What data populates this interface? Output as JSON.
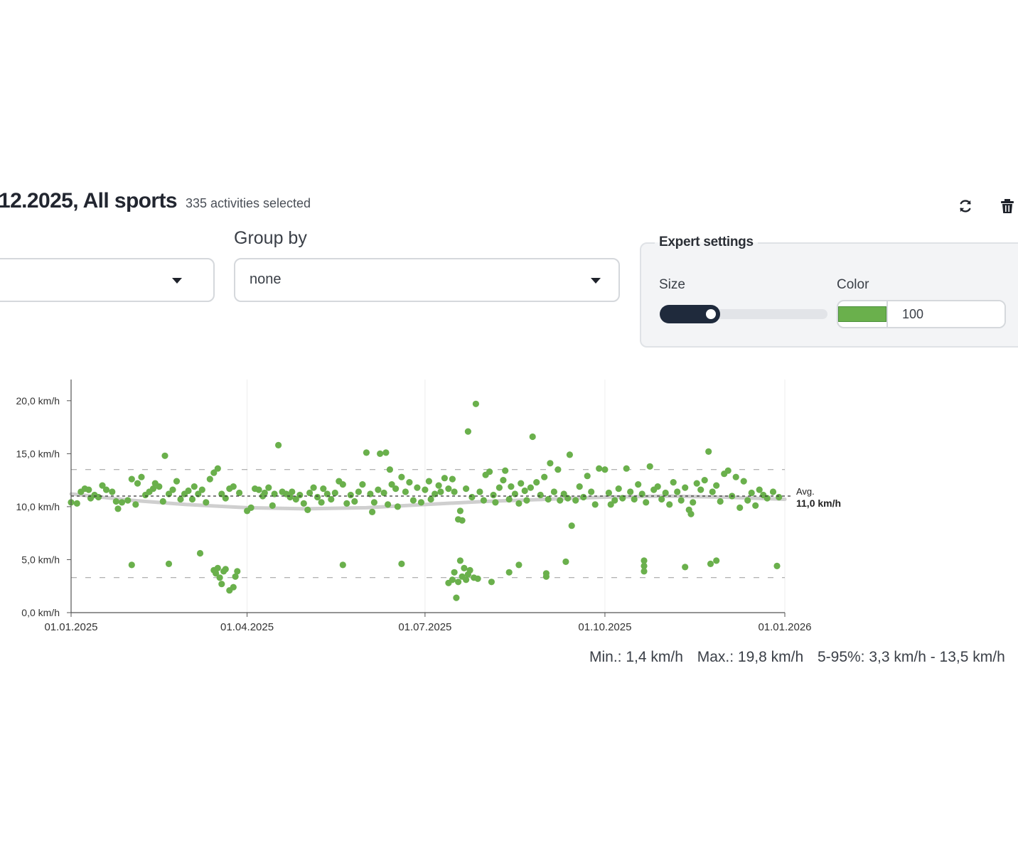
{
  "header": {
    "title": "12.2025, All sports",
    "subtitle": "335 activities selected",
    "refresh_icon": "refresh-icon",
    "delete_icon": "trash-icon"
  },
  "filters": {
    "first_select": {
      "value": ""
    },
    "group_by": {
      "label": "Group by",
      "value": "none"
    }
  },
  "expert": {
    "legend": "Expert settings",
    "size_label": "Size",
    "size_value": 0.36,
    "color_label": "Color",
    "color": "#6ab04c",
    "opacity": "100"
  },
  "stats": {
    "min": "Min.: 1,4 km/h",
    "max": "Max.: 19,8 km/h",
    "range": "5-95%: 3,3 km/h - 13,5 km/h"
  },
  "chart_data": {
    "type": "scatter",
    "title": "",
    "xlabel": "",
    "ylabel": "",
    "unit": "km/h",
    "x_range": [
      "2025-01-01",
      "2026-01-01"
    ],
    "ylim": [
      0,
      22
    ],
    "x_ticks": [
      {
        "date": "2025-01-01",
        "label": "01.01.2025"
      },
      {
        "date": "2025-04-01",
        "label": "01.04.2025"
      },
      {
        "date": "2025-07-01",
        "label": "01.07.2025"
      },
      {
        "date": "2025-10-01",
        "label": "01.10.2025"
      },
      {
        "date": "2026-01-01",
        "label": "01.01.2026"
      }
    ],
    "y_ticks": [
      {
        "value": 0,
        "label": "0,0 km/h"
      },
      {
        "value": 5,
        "label": "5,0 km/h"
      },
      {
        "value": 10,
        "label": "10,0 km/h"
      },
      {
        "value": 15,
        "label": "15,0 km/h"
      },
      {
        "value": 20,
        "label": "20,0 km/h"
      }
    ],
    "average": {
      "value": 11.0,
      "label": "Avg.",
      "value_label": "11,0 km/h"
    },
    "percentile_lines": [
      3.3,
      13.5
    ],
    "trend": [
      {
        "x": "2025-01-01",
        "y": 11.2
      },
      {
        "x": "2025-02-01",
        "y": 10.6
      },
      {
        "x": "2025-03-01",
        "y": 10.2
      },
      {
        "x": "2025-04-01",
        "y": 9.9
      },
      {
        "x": "2025-05-01",
        "y": 9.8
      },
      {
        "x": "2025-06-01",
        "y": 9.9
      },
      {
        "x": "2025-07-01",
        "y": 10.2
      },
      {
        "x": "2025-08-01",
        "y": 10.5
      },
      {
        "x": "2025-09-01",
        "y": 10.7
      },
      {
        "x": "2025-10-01",
        "y": 10.9
      },
      {
        "x": "2025-11-01",
        "y": 11.0
      },
      {
        "x": "2025-12-01",
        "y": 10.9
      },
      {
        "x": "2026-01-01",
        "y": 10.7
      }
    ],
    "points": [
      {
        "x": "2025-01-01",
        "y": 10.4
      },
      {
        "x": "2025-01-04",
        "y": 10.3
      },
      {
        "x": "2025-01-06",
        "y": 11.4
      },
      {
        "x": "2025-01-08",
        "y": 11.7
      },
      {
        "x": "2025-01-10",
        "y": 11.6
      },
      {
        "x": "2025-01-11",
        "y": 10.8
      },
      {
        "x": "2025-01-13",
        "y": 11.1
      },
      {
        "x": "2025-01-15",
        "y": 10.9
      },
      {
        "x": "2025-01-17",
        "y": 12.0
      },
      {
        "x": "2025-01-19",
        "y": 11.6
      },
      {
        "x": "2025-01-22",
        "y": 11.4
      },
      {
        "x": "2025-01-24",
        "y": 10.5
      },
      {
        "x": "2025-01-25",
        "y": 9.8
      },
      {
        "x": "2025-01-27",
        "y": 10.4
      },
      {
        "x": "2025-01-30",
        "y": 10.6
      },
      {
        "x": "2025-02-01",
        "y": 12.6
      },
      {
        "x": "2025-02-03",
        "y": 10.2
      },
      {
        "x": "2025-02-04",
        "y": 12.2
      },
      {
        "x": "2025-02-06",
        "y": 12.8
      },
      {
        "x": "2025-02-08",
        "y": 11.1
      },
      {
        "x": "2025-02-10",
        "y": 11.4
      },
      {
        "x": "2025-02-12",
        "y": 11.7
      },
      {
        "x": "2025-02-13",
        "y": 12.2
      },
      {
        "x": "2025-02-15",
        "y": 11.9
      },
      {
        "x": "2025-02-17",
        "y": 10.5
      },
      {
        "x": "2025-02-18",
        "y": 14.8
      },
      {
        "x": "2025-02-20",
        "y": 11.2
      },
      {
        "x": "2025-02-22",
        "y": 11.6
      },
      {
        "x": "2025-02-24",
        "y": 12.4
      },
      {
        "x": "2025-02-26",
        "y": 10.7
      },
      {
        "x": "2025-02-28",
        "y": 11.2
      },
      {
        "x": "2025-03-02",
        "y": 11.5
      },
      {
        "x": "2025-03-04",
        "y": 10.7
      },
      {
        "x": "2025-03-05",
        "y": 11.9
      },
      {
        "x": "2025-03-07",
        "y": 11.2
      },
      {
        "x": "2025-03-09",
        "y": 11.6
      },
      {
        "x": "2025-03-11",
        "y": 10.4
      },
      {
        "x": "2025-03-13",
        "y": 12.6
      },
      {
        "x": "2025-03-15",
        "y": 13.2
      },
      {
        "x": "2025-03-17",
        "y": 13.6
      },
      {
        "x": "2025-03-19",
        "y": 11.2
      },
      {
        "x": "2025-03-21",
        "y": 10.8
      },
      {
        "x": "2025-03-23",
        "y": 11.7
      },
      {
        "x": "2025-03-25",
        "y": 11.9
      },
      {
        "x": "2025-03-28",
        "y": 11.3
      },
      {
        "x": "2025-04-01",
        "y": 9.6
      },
      {
        "x": "2025-04-03",
        "y": 9.9
      },
      {
        "x": "2025-04-05",
        "y": 11.7
      },
      {
        "x": "2025-04-07",
        "y": 11.6
      },
      {
        "x": "2025-04-09",
        "y": 11.0
      },
      {
        "x": "2025-04-10",
        "y": 11.3
      },
      {
        "x": "2025-04-12",
        "y": 11.8
      },
      {
        "x": "2025-04-14",
        "y": 10.1
      },
      {
        "x": "2025-04-15",
        "y": 11.2
      },
      {
        "x": "2025-04-17",
        "y": 15.8
      },
      {
        "x": "2025-04-19",
        "y": 11.4
      },
      {
        "x": "2025-04-21",
        "y": 11.2
      },
      {
        "x": "2025-04-23",
        "y": 10.9
      },
      {
        "x": "2025-04-24",
        "y": 11.4
      },
      {
        "x": "2025-04-26",
        "y": 10.7
      },
      {
        "x": "2025-04-28",
        "y": 11.1
      },
      {
        "x": "2025-04-30",
        "y": 10.3
      },
      {
        "x": "2025-05-02",
        "y": 9.7
      },
      {
        "x": "2025-05-03",
        "y": 11.3
      },
      {
        "x": "2025-05-05",
        "y": 11.8
      },
      {
        "x": "2025-05-07",
        "y": 10.9
      },
      {
        "x": "2025-05-09",
        "y": 10.4
      },
      {
        "x": "2025-05-10",
        "y": 11.7
      },
      {
        "x": "2025-05-12",
        "y": 11.2
      },
      {
        "x": "2025-05-14",
        "y": 10.7
      },
      {
        "x": "2025-05-16",
        "y": 11.3
      },
      {
        "x": "2025-05-18",
        "y": 12.4
      },
      {
        "x": "2025-05-20",
        "y": 12.1
      },
      {
        "x": "2025-05-22",
        "y": 10.3
      },
      {
        "x": "2025-05-24",
        "y": 11.1
      },
      {
        "x": "2025-05-26",
        "y": 10.5
      },
      {
        "x": "2025-05-28",
        "y": 11.4
      },
      {
        "x": "2025-05-30",
        "y": 12.1
      },
      {
        "x": "2025-06-01",
        "y": 15.1
      },
      {
        "x": "2025-06-03",
        "y": 11.2
      },
      {
        "x": "2025-06-04",
        "y": 9.5
      },
      {
        "x": "2025-06-05",
        "y": 10.4
      },
      {
        "x": "2025-06-07",
        "y": 11.6
      },
      {
        "x": "2025-06-08",
        "y": 15.0
      },
      {
        "x": "2025-06-10",
        "y": 11.3
      },
      {
        "x": "2025-06-11",
        "y": 15.1
      },
      {
        "x": "2025-06-12",
        "y": 10.2
      },
      {
        "x": "2025-06-13",
        "y": 13.5
      },
      {
        "x": "2025-06-14",
        "y": 12.1
      },
      {
        "x": "2025-06-16",
        "y": 11.7
      },
      {
        "x": "2025-06-17",
        "y": 10.0
      },
      {
        "x": "2025-06-19",
        "y": 12.8
      },
      {
        "x": "2025-06-21",
        "y": 11.4
      },
      {
        "x": "2025-06-23",
        "y": 12.3
      },
      {
        "x": "2025-06-25",
        "y": 10.6
      },
      {
        "x": "2025-06-27",
        "y": 11.8
      },
      {
        "x": "2025-06-29",
        "y": 10.4
      },
      {
        "x": "2025-07-01",
        "y": 11.6
      },
      {
        "x": "2025-07-03",
        "y": 12.4
      },
      {
        "x": "2025-07-04",
        "y": 10.7
      },
      {
        "x": "2025-07-06",
        "y": 11.2
      },
      {
        "x": "2025-07-08",
        "y": 12.0
      },
      {
        "x": "2025-07-09",
        "y": 11.4
      },
      {
        "x": "2025-07-11",
        "y": 12.7
      },
      {
        "x": "2025-07-13",
        "y": 11.7
      },
      {
        "x": "2025-07-15",
        "y": 12.6
      },
      {
        "x": "2025-07-16",
        "y": 11.4
      },
      {
        "x": "2025-07-18",
        "y": 8.8
      },
      {
        "x": "2025-07-19",
        "y": 9.6
      },
      {
        "x": "2025-07-20",
        "y": 8.7
      },
      {
        "x": "2025-07-22",
        "y": 11.7
      },
      {
        "x": "2025-07-23",
        "y": 17.1
      },
      {
        "x": "2025-07-25",
        "y": 10.9
      },
      {
        "x": "2025-07-27",
        "y": 19.7
      },
      {
        "x": "2025-07-29",
        "y": 11.4
      },
      {
        "x": "2025-07-31",
        "y": 10.6
      },
      {
        "x": "2025-08-01",
        "y": 13.0
      },
      {
        "x": "2025-08-03",
        "y": 13.3
      },
      {
        "x": "2025-08-05",
        "y": 11.1
      },
      {
        "x": "2025-08-06",
        "y": 10.4
      },
      {
        "x": "2025-08-08",
        "y": 11.8
      },
      {
        "x": "2025-08-10",
        "y": 12.5
      },
      {
        "x": "2025-08-11",
        "y": 13.4
      },
      {
        "x": "2025-08-13",
        "y": 10.7
      },
      {
        "x": "2025-08-14",
        "y": 11.9
      },
      {
        "x": "2025-08-16",
        "y": 11.2
      },
      {
        "x": "2025-08-18",
        "y": 10.3
      },
      {
        "x": "2025-08-19",
        "y": 12.2
      },
      {
        "x": "2025-08-21",
        "y": 11.5
      },
      {
        "x": "2025-08-22",
        "y": 10.6
      },
      {
        "x": "2025-08-24",
        "y": 11.8
      },
      {
        "x": "2025-08-25",
        "y": 16.6
      },
      {
        "x": "2025-08-27",
        "y": 12.3
      },
      {
        "x": "2025-08-29",
        "y": 11.1
      },
      {
        "x": "2025-08-31",
        "y": 12.8
      },
      {
        "x": "2025-09-02",
        "y": 10.7
      },
      {
        "x": "2025-09-03",
        "y": 14.1
      },
      {
        "x": "2025-09-05",
        "y": 11.4
      },
      {
        "x": "2025-09-07",
        "y": 13.5
      },
      {
        "x": "2025-09-08",
        "y": 10.6
      },
      {
        "x": "2025-09-10",
        "y": 11.2
      },
      {
        "x": "2025-09-12",
        "y": 10.8
      },
      {
        "x": "2025-09-13",
        "y": 14.9
      },
      {
        "x": "2025-09-14",
        "y": 8.2
      },
      {
        "x": "2025-09-16",
        "y": 10.6
      },
      {
        "x": "2025-09-18",
        "y": 11.9
      },
      {
        "x": "2025-09-20",
        "y": 10.9
      },
      {
        "x": "2025-09-22",
        "y": 12.9
      },
      {
        "x": "2025-09-24",
        "y": 11.4
      },
      {
        "x": "2025-09-26",
        "y": 10.2
      },
      {
        "x": "2025-09-28",
        "y": 13.6
      },
      {
        "x": "2025-10-01",
        "y": 13.5
      },
      {
        "x": "2025-10-03",
        "y": 11.3
      },
      {
        "x": "2025-10-04",
        "y": 10.2
      },
      {
        "x": "2025-10-06",
        "y": 10.6
      },
      {
        "x": "2025-10-08",
        "y": 11.7
      },
      {
        "x": "2025-10-10",
        "y": 10.8
      },
      {
        "x": "2025-10-12",
        "y": 13.6
      },
      {
        "x": "2025-10-14",
        "y": 11.4
      },
      {
        "x": "2025-10-16",
        "y": 10.7
      },
      {
        "x": "2025-10-18",
        "y": 12.1
      },
      {
        "x": "2025-10-20",
        "y": 11.2
      },
      {
        "x": "2025-10-22",
        "y": 10.4
      },
      {
        "x": "2025-10-24",
        "y": 13.8
      },
      {
        "x": "2025-10-26",
        "y": 11.6
      },
      {
        "x": "2025-10-28",
        "y": 11.9
      },
      {
        "x": "2025-10-30",
        "y": 10.7
      },
      {
        "x": "2025-11-01",
        "y": 11.3
      },
      {
        "x": "2025-11-03",
        "y": 10.2
      },
      {
        "x": "2025-11-05",
        "y": 12.3
      },
      {
        "x": "2025-11-07",
        "y": 11.4
      },
      {
        "x": "2025-11-09",
        "y": 10.6
      },
      {
        "x": "2025-11-11",
        "y": 11.8
      },
      {
        "x": "2025-11-13",
        "y": 9.7
      },
      {
        "x": "2025-11-14",
        "y": 9.3
      },
      {
        "x": "2025-11-15",
        "y": 10.4
      },
      {
        "x": "2025-11-17",
        "y": 12.2
      },
      {
        "x": "2025-11-19",
        "y": 11.6
      },
      {
        "x": "2025-11-21",
        "y": 12.5
      },
      {
        "x": "2025-11-23",
        "y": 15.2
      },
      {
        "x": "2025-11-25",
        "y": 11.4
      },
      {
        "x": "2025-11-27",
        "y": 12.0
      },
      {
        "x": "2025-11-29",
        "y": 10.5
      },
      {
        "x": "2025-12-01",
        "y": 13.1
      },
      {
        "x": "2025-12-03",
        "y": 13.4
      },
      {
        "x": "2025-12-05",
        "y": 11.0
      },
      {
        "x": "2025-12-07",
        "y": 12.8
      },
      {
        "x": "2025-12-09",
        "y": 9.9
      },
      {
        "x": "2025-12-11",
        "y": 12.4
      },
      {
        "x": "2025-12-13",
        "y": 10.6
      },
      {
        "x": "2025-12-15",
        "y": 11.3
      },
      {
        "x": "2025-12-17",
        "y": 10.1
      },
      {
        "x": "2025-12-19",
        "y": 11.6
      },
      {
        "x": "2025-12-21",
        "y": 11.1
      },
      {
        "x": "2025-12-23",
        "y": 10.8
      },
      {
        "x": "2025-12-26",
        "y": 11.4
      },
      {
        "x": "2025-12-29",
        "y": 10.9
      },
      {
        "x": "2025-02-01",
        "y": 4.5
      },
      {
        "x": "2025-02-20",
        "y": 4.6
      },
      {
        "x": "2025-03-08",
        "y": 5.6
      },
      {
        "x": "2025-03-15",
        "y": 4.0
      },
      {
        "x": "2025-03-16",
        "y": 3.7
      },
      {
        "x": "2025-03-17",
        "y": 4.2
      },
      {
        "x": "2025-03-18",
        "y": 3.3
      },
      {
        "x": "2025-03-19",
        "y": 2.7
      },
      {
        "x": "2025-03-20",
        "y": 3.9
      },
      {
        "x": "2025-03-21",
        "y": 4.1
      },
      {
        "x": "2025-03-23",
        "y": 2.1
      },
      {
        "x": "2025-03-25",
        "y": 2.4
      },
      {
        "x": "2025-03-26",
        "y": 3.4
      },
      {
        "x": "2025-03-27",
        "y": 3.9
      },
      {
        "x": "2025-05-20",
        "y": 4.5
      },
      {
        "x": "2025-06-19",
        "y": 4.6
      },
      {
        "x": "2025-07-13",
        "y": 2.8
      },
      {
        "x": "2025-07-15",
        "y": 3.1
      },
      {
        "x": "2025-07-16",
        "y": 3.8
      },
      {
        "x": "2025-07-17",
        "y": 1.4
      },
      {
        "x": "2025-07-18",
        "y": 2.9
      },
      {
        "x": "2025-07-19",
        "y": 4.9
      },
      {
        "x": "2025-07-20",
        "y": 3.4
      },
      {
        "x": "2025-07-21",
        "y": 4.2
      },
      {
        "x": "2025-07-22",
        "y": 3.1
      },
      {
        "x": "2025-07-23",
        "y": 3.6
      },
      {
        "x": "2025-07-24",
        "y": 4.0
      },
      {
        "x": "2025-07-26",
        "y": 3.3
      },
      {
        "x": "2025-07-28",
        "y": 3.2
      },
      {
        "x": "2025-08-04",
        "y": 2.9
      },
      {
        "x": "2025-08-13",
        "y": 3.8
      },
      {
        "x": "2025-08-18",
        "y": 4.5
      },
      {
        "x": "2025-09-01",
        "y": 3.7
      },
      {
        "x": "2025-09-01",
        "y": 3.4
      },
      {
        "x": "2025-09-11",
        "y": 4.8
      },
      {
        "x": "2025-10-21",
        "y": 4.9
      },
      {
        "x": "2025-10-21",
        "y": 4.4
      },
      {
        "x": "2025-10-21",
        "y": 3.9
      },
      {
        "x": "2025-11-11",
        "y": 4.3
      },
      {
        "x": "2025-11-24",
        "y": 4.6
      },
      {
        "x": "2025-11-27",
        "y": 4.9
      },
      {
        "x": "2025-12-28",
        "y": 4.4
      }
    ]
  }
}
